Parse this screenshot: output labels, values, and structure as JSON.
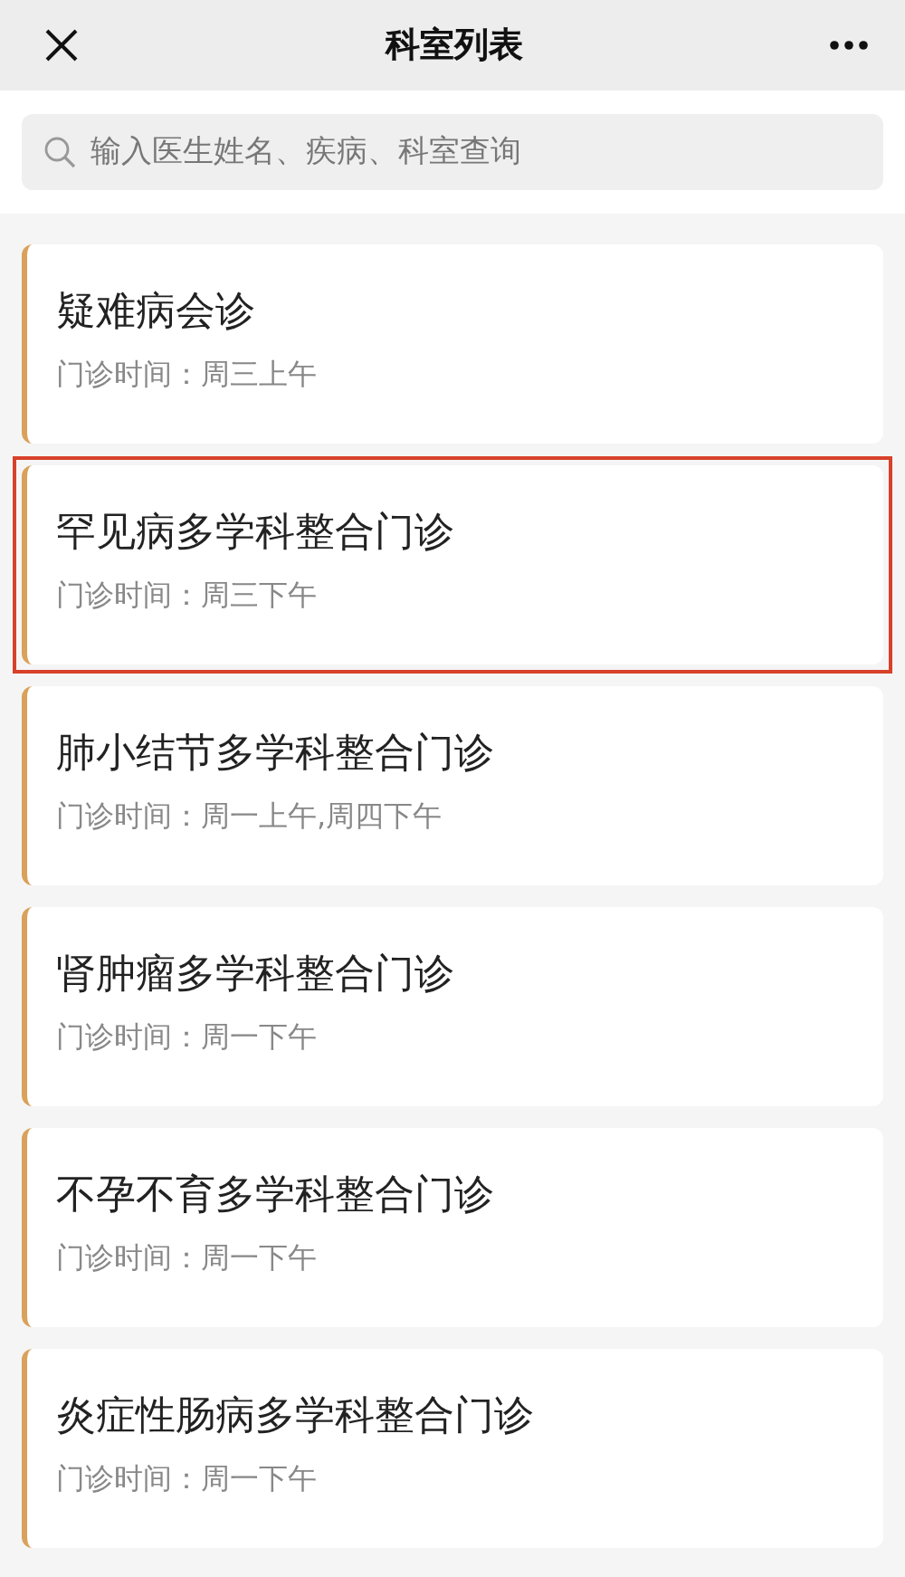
{
  "header": {
    "title": "科室列表"
  },
  "search": {
    "placeholder": "输入医生姓名、疾病、科室查询"
  },
  "departments": [
    {
      "name": "疑难病会诊",
      "hours": "门诊时间：周三上午",
      "selected": false
    },
    {
      "name": "罕见病多学科整合门诊",
      "hours": "门诊时间：周三下午",
      "selected": true
    },
    {
      "name": "肺小结节多学科整合门诊",
      "hours": "门诊时间：周一上午,周四下午",
      "selected": false
    },
    {
      "name": "肾肿瘤多学科整合门诊",
      "hours": "门诊时间：周一下午",
      "selected": false
    },
    {
      "name": "不孕不育多学科整合门诊",
      "hours": "门诊时间：周一下午",
      "selected": false
    },
    {
      "name": "炎症性肠病多学科整合门诊",
      "hours": "门诊时间：周一下午",
      "selected": false
    }
  ]
}
